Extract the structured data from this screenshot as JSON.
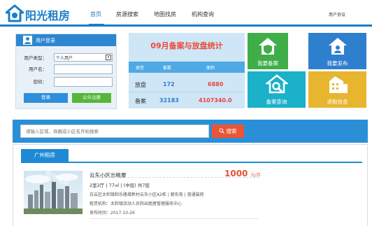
{
  "header": {
    "brand": "阳光租房",
    "nav": [
      "首页",
      "房源搜索",
      "地图找房",
      "机构查询"
    ],
    "user_agreement": "用户协议"
  },
  "login": {
    "title": "用户登录",
    "user_type_label": "用户类型：",
    "user_type_value": "个人用户",
    "username_label": "用户名：",
    "password_label": "密码：",
    "login_button": "登录",
    "register_button": "公众注册"
  },
  "stats": {
    "title": "09月备案与放盘统计",
    "columns": [
      "类型",
      "套数",
      "面积"
    ],
    "rows": [
      {
        "type": "放盘",
        "count": "172",
        "area": "6880"
      },
      {
        "type": "备案",
        "count": "32183",
        "area": "4107340.0"
      }
    ]
  },
  "tiles": [
    {
      "label": "我要备案",
      "color": "#3fae49",
      "icon": "house-shield-icon"
    },
    {
      "label": "我要发布",
      "color": "#2f7fcf",
      "icon": "house-user-icon"
    },
    {
      "label": "备案查询",
      "color": "#1bb1c9",
      "icon": "house-search-icon"
    },
    {
      "label": "求租信息",
      "color": "#e7b52e",
      "icon": "buildings-icon"
    }
  ],
  "search": {
    "placeholder": "请输入区域、商圈或小区名开始搜索",
    "button": "搜索"
  },
  "section": {
    "tab": "广州租房"
  },
  "listing": {
    "title": "云东小区出租屋",
    "spec": "2室2厅 | 77㎡ | (中层) 共7层",
    "address": "白云区太和镇和乐路增新村云东小区A2栋 | 朝东南 | 普通装修",
    "agent": "租赁机构：太和镇流动人员和出租屋管理服务中心",
    "date": "发布时间：2017-10-26",
    "price": "1000",
    "price_unit": "元/月",
    "watermark": "阳光租房"
  },
  "colors": {
    "brand_blue": "#1a7ec9",
    "accent_red": "#e8503a",
    "register_green": "#55b63a"
  }
}
